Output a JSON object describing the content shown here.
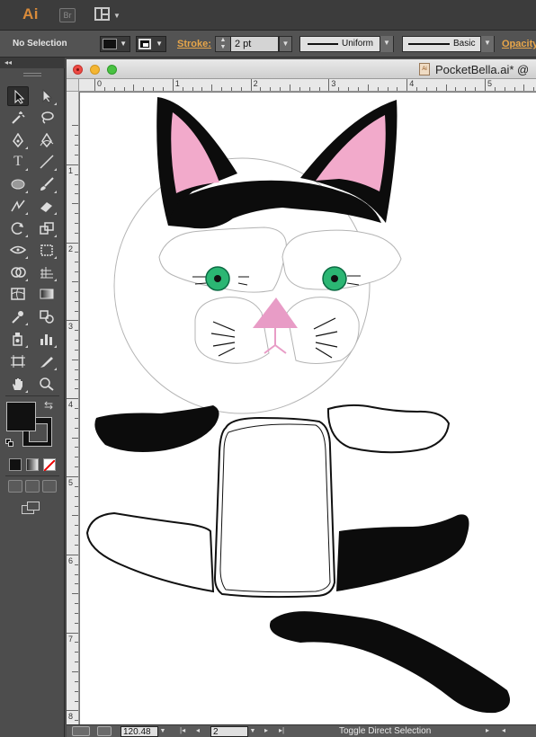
{
  "app": {
    "logo": "Ai",
    "bridge_logo": "Br"
  },
  "control_bar": {
    "selection_status": "No Selection",
    "stroke_label": "Stroke:",
    "stroke_weight": "2 pt",
    "variable_width_profile": "Uniform",
    "brush_definition": "Basic",
    "opacity_label": "Opacity:"
  },
  "colors": {
    "accent_orange": "#e8a64a",
    "fill_color": "#111111",
    "stroke_color": "#111111",
    "cat_ear_pink": "#f2aacb",
    "nose_pink": "#e38fc0",
    "eye_green": "#2bb673"
  },
  "tools": {
    "selected": "selection-tool",
    "items": [
      "selection-tool",
      "direct-selection-tool",
      "magic-wand-tool",
      "lasso-tool",
      "pen-tool",
      "curvature-tool",
      "type-tool",
      "line-segment-tool",
      "ellipse-tool",
      "paintbrush-tool",
      "shaper-tool",
      "eraser-tool",
      "rotate-tool",
      "scale-tool",
      "width-tool",
      "free-transform-tool",
      "shape-builder-tool",
      "perspective-grid-tool",
      "mesh-tool",
      "gradient-tool",
      "eyedropper-tool",
      "blend-tool",
      "symbol-sprayer-tool",
      "column-graph-tool",
      "artboard-tool",
      "slice-tool",
      "hand-tool",
      "zoom-tool"
    ]
  },
  "document": {
    "title": "PocketBella.ai* @",
    "ruler_h_labels": [
      "0",
      "1",
      "2",
      "3",
      "4",
      "5"
    ],
    "ruler_v_labels": [
      "1",
      "2",
      "3",
      "4",
      "5",
      "6",
      "7",
      "8"
    ]
  },
  "status_bar": {
    "zoom": "120.48",
    "artboard_number": "2",
    "current_tool_status": "Toggle Direct Selection"
  }
}
